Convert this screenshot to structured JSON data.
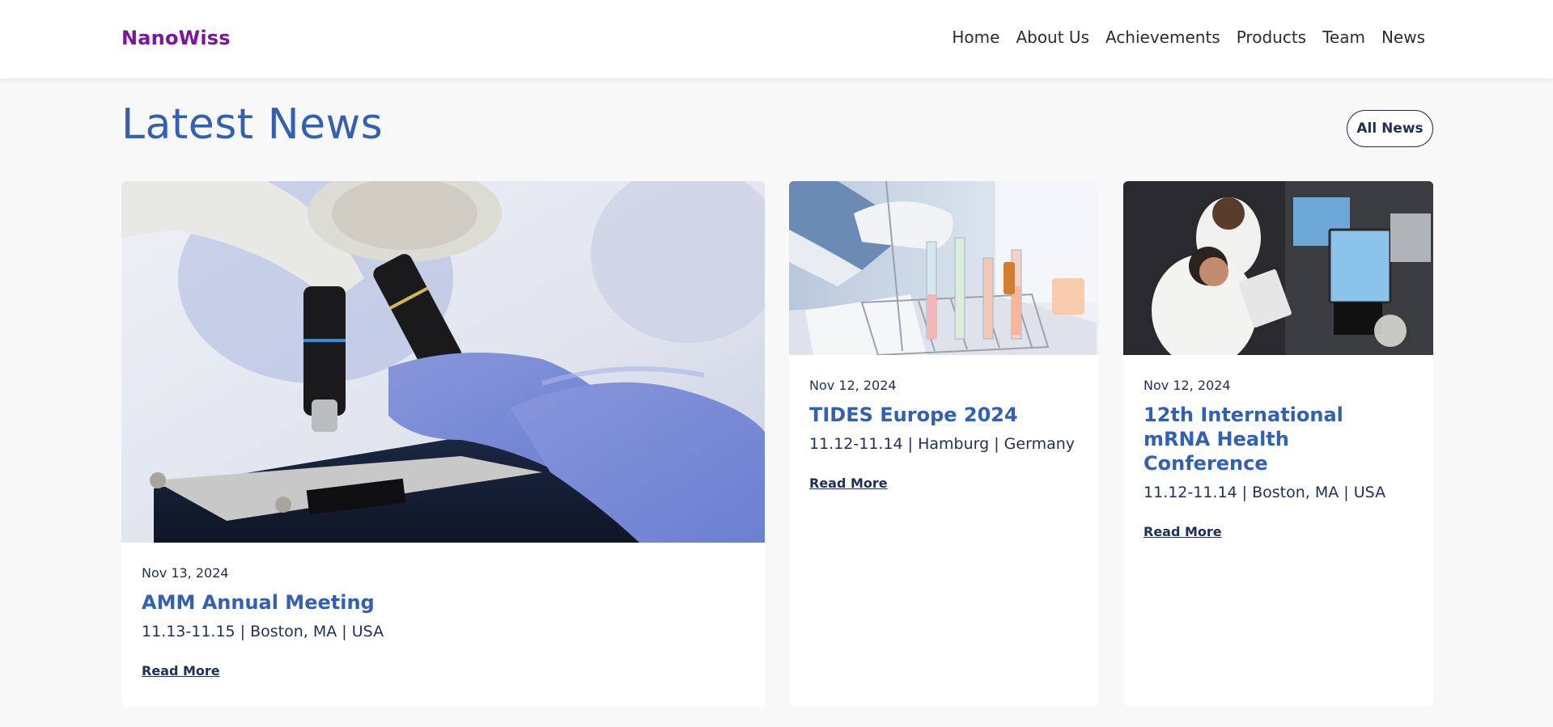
{
  "header": {
    "logo": "NanoWiss",
    "nav": [
      "Home",
      "About Us",
      "Achievements",
      "Products",
      "Team",
      "News"
    ]
  },
  "section": {
    "title": "Latest News",
    "all_news_label": "All News"
  },
  "cards": [
    {
      "date": "Nov 13, 2024",
      "title": "AMM Annual Meeting",
      "meta": "11.13-11.15 | Boston, MA | USA",
      "read_more": "Read More",
      "image": "microscope-gloved-hands-photo"
    },
    {
      "date": "Nov 12, 2024",
      "title": "TIDES Europe 2024",
      "meta": "11.12-11.14 | Hamburg | Germany",
      "read_more": "Read More",
      "image": "test-tubes-rack-photo"
    },
    {
      "date": "Nov 12, 2024",
      "title": "12th International mRNA Health Conference",
      "meta": "11.12-11.14 | Boston, MA | USA",
      "read_more": "Read More",
      "image": "scientists-computers-lab-photo"
    }
  ],
  "colors": {
    "brand": "#7a169a",
    "accent": "#3360b0",
    "text": "#1f2f57",
    "background": "#f8f8f8"
  }
}
